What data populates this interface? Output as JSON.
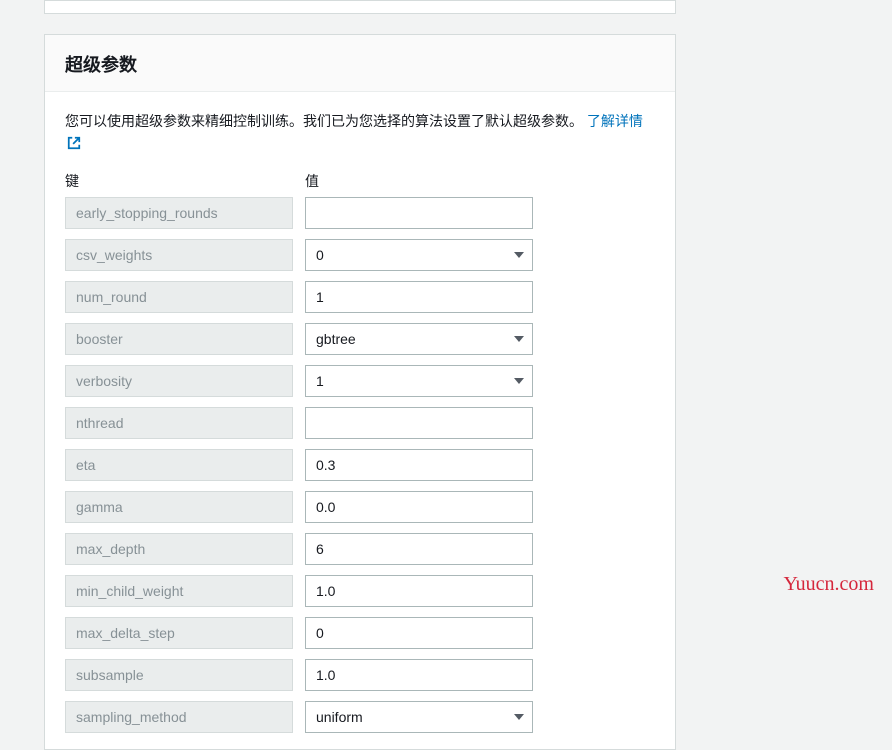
{
  "panel": {
    "title": "超级参数",
    "description": "您可以使用超级参数来精细控制训练。我们已为您选择的算法设置了默认超级参数。",
    "learn_more": "了解详情"
  },
  "columns": {
    "key": "键",
    "value": "值"
  },
  "rows": [
    {
      "key": "early_stopping_rounds",
      "type": "text",
      "value": ""
    },
    {
      "key": "csv_weights",
      "type": "select",
      "value": "0"
    },
    {
      "key": "num_round",
      "type": "text",
      "value": "1"
    },
    {
      "key": "booster",
      "type": "select",
      "value": "gbtree"
    },
    {
      "key": "verbosity",
      "type": "select",
      "value": "1"
    },
    {
      "key": "nthread",
      "type": "text",
      "value": ""
    },
    {
      "key": "eta",
      "type": "text",
      "value": "0.3"
    },
    {
      "key": "gamma",
      "type": "text",
      "value": "0.0"
    },
    {
      "key": "max_depth",
      "type": "text",
      "value": "6"
    },
    {
      "key": "min_child_weight",
      "type": "text",
      "value": "1.0"
    },
    {
      "key": "max_delta_step",
      "type": "text",
      "value": "0"
    },
    {
      "key": "subsample",
      "type": "text",
      "value": "1.0"
    },
    {
      "key": "sampling_method",
      "type": "select",
      "value": "uniform"
    }
  ],
  "watermark": "Yuucn.com"
}
